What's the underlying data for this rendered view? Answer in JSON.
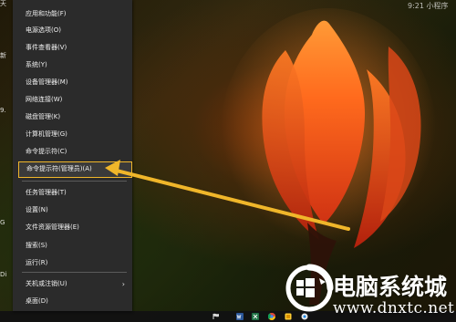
{
  "desktop": {
    "top_left_labels": [
      "天",
      "新",
      "9.",
      "G",
      "Di"
    ],
    "clock_text": "9:21 小程序",
    "bottom_left_text": "Di"
  },
  "menu": {
    "items": [
      {
        "label": "应用和功能(F)",
        "submenu": false
      },
      {
        "label": "电源选项(O)",
        "submenu": false
      },
      {
        "label": "事件查看器(V)",
        "submenu": false
      },
      {
        "label": "系统(Y)",
        "submenu": false
      },
      {
        "label": "设备管理器(M)",
        "submenu": false
      },
      {
        "label": "网络连接(W)",
        "submenu": false
      },
      {
        "label": "磁盘管理(K)",
        "submenu": false
      },
      {
        "label": "计算机管理(G)",
        "submenu": false
      },
      {
        "label": "命令提示符(C)",
        "submenu": false
      },
      {
        "label": "命令提示符(管理员)(A)",
        "submenu": false,
        "highlighted": true
      },
      {
        "label": "任务管理器(T)",
        "submenu": false
      },
      {
        "label": "设置(N)",
        "submenu": false
      },
      {
        "label": "文件资源管理器(E)",
        "submenu": false
      },
      {
        "label": "搜索(S)",
        "submenu": false
      },
      {
        "label": "运行(R)",
        "submenu": false
      },
      {
        "label": "关机或注销(U)",
        "submenu": true
      },
      {
        "label": "桌面(D)",
        "submenu": false
      }
    ]
  },
  "taskbar": {
    "icons": [
      "flag-icon",
      "word-icon",
      "excel-icon",
      "chrome-icon",
      "app-icon",
      "app-icon-2"
    ]
  },
  "watermark": {
    "title": "电脑系统城",
    "url": "www.dnxtc.net"
  },
  "colors": {
    "menu_bg": "#2b2b2b",
    "highlight": "#f0b62a",
    "flower": "#ff5a1c"
  }
}
